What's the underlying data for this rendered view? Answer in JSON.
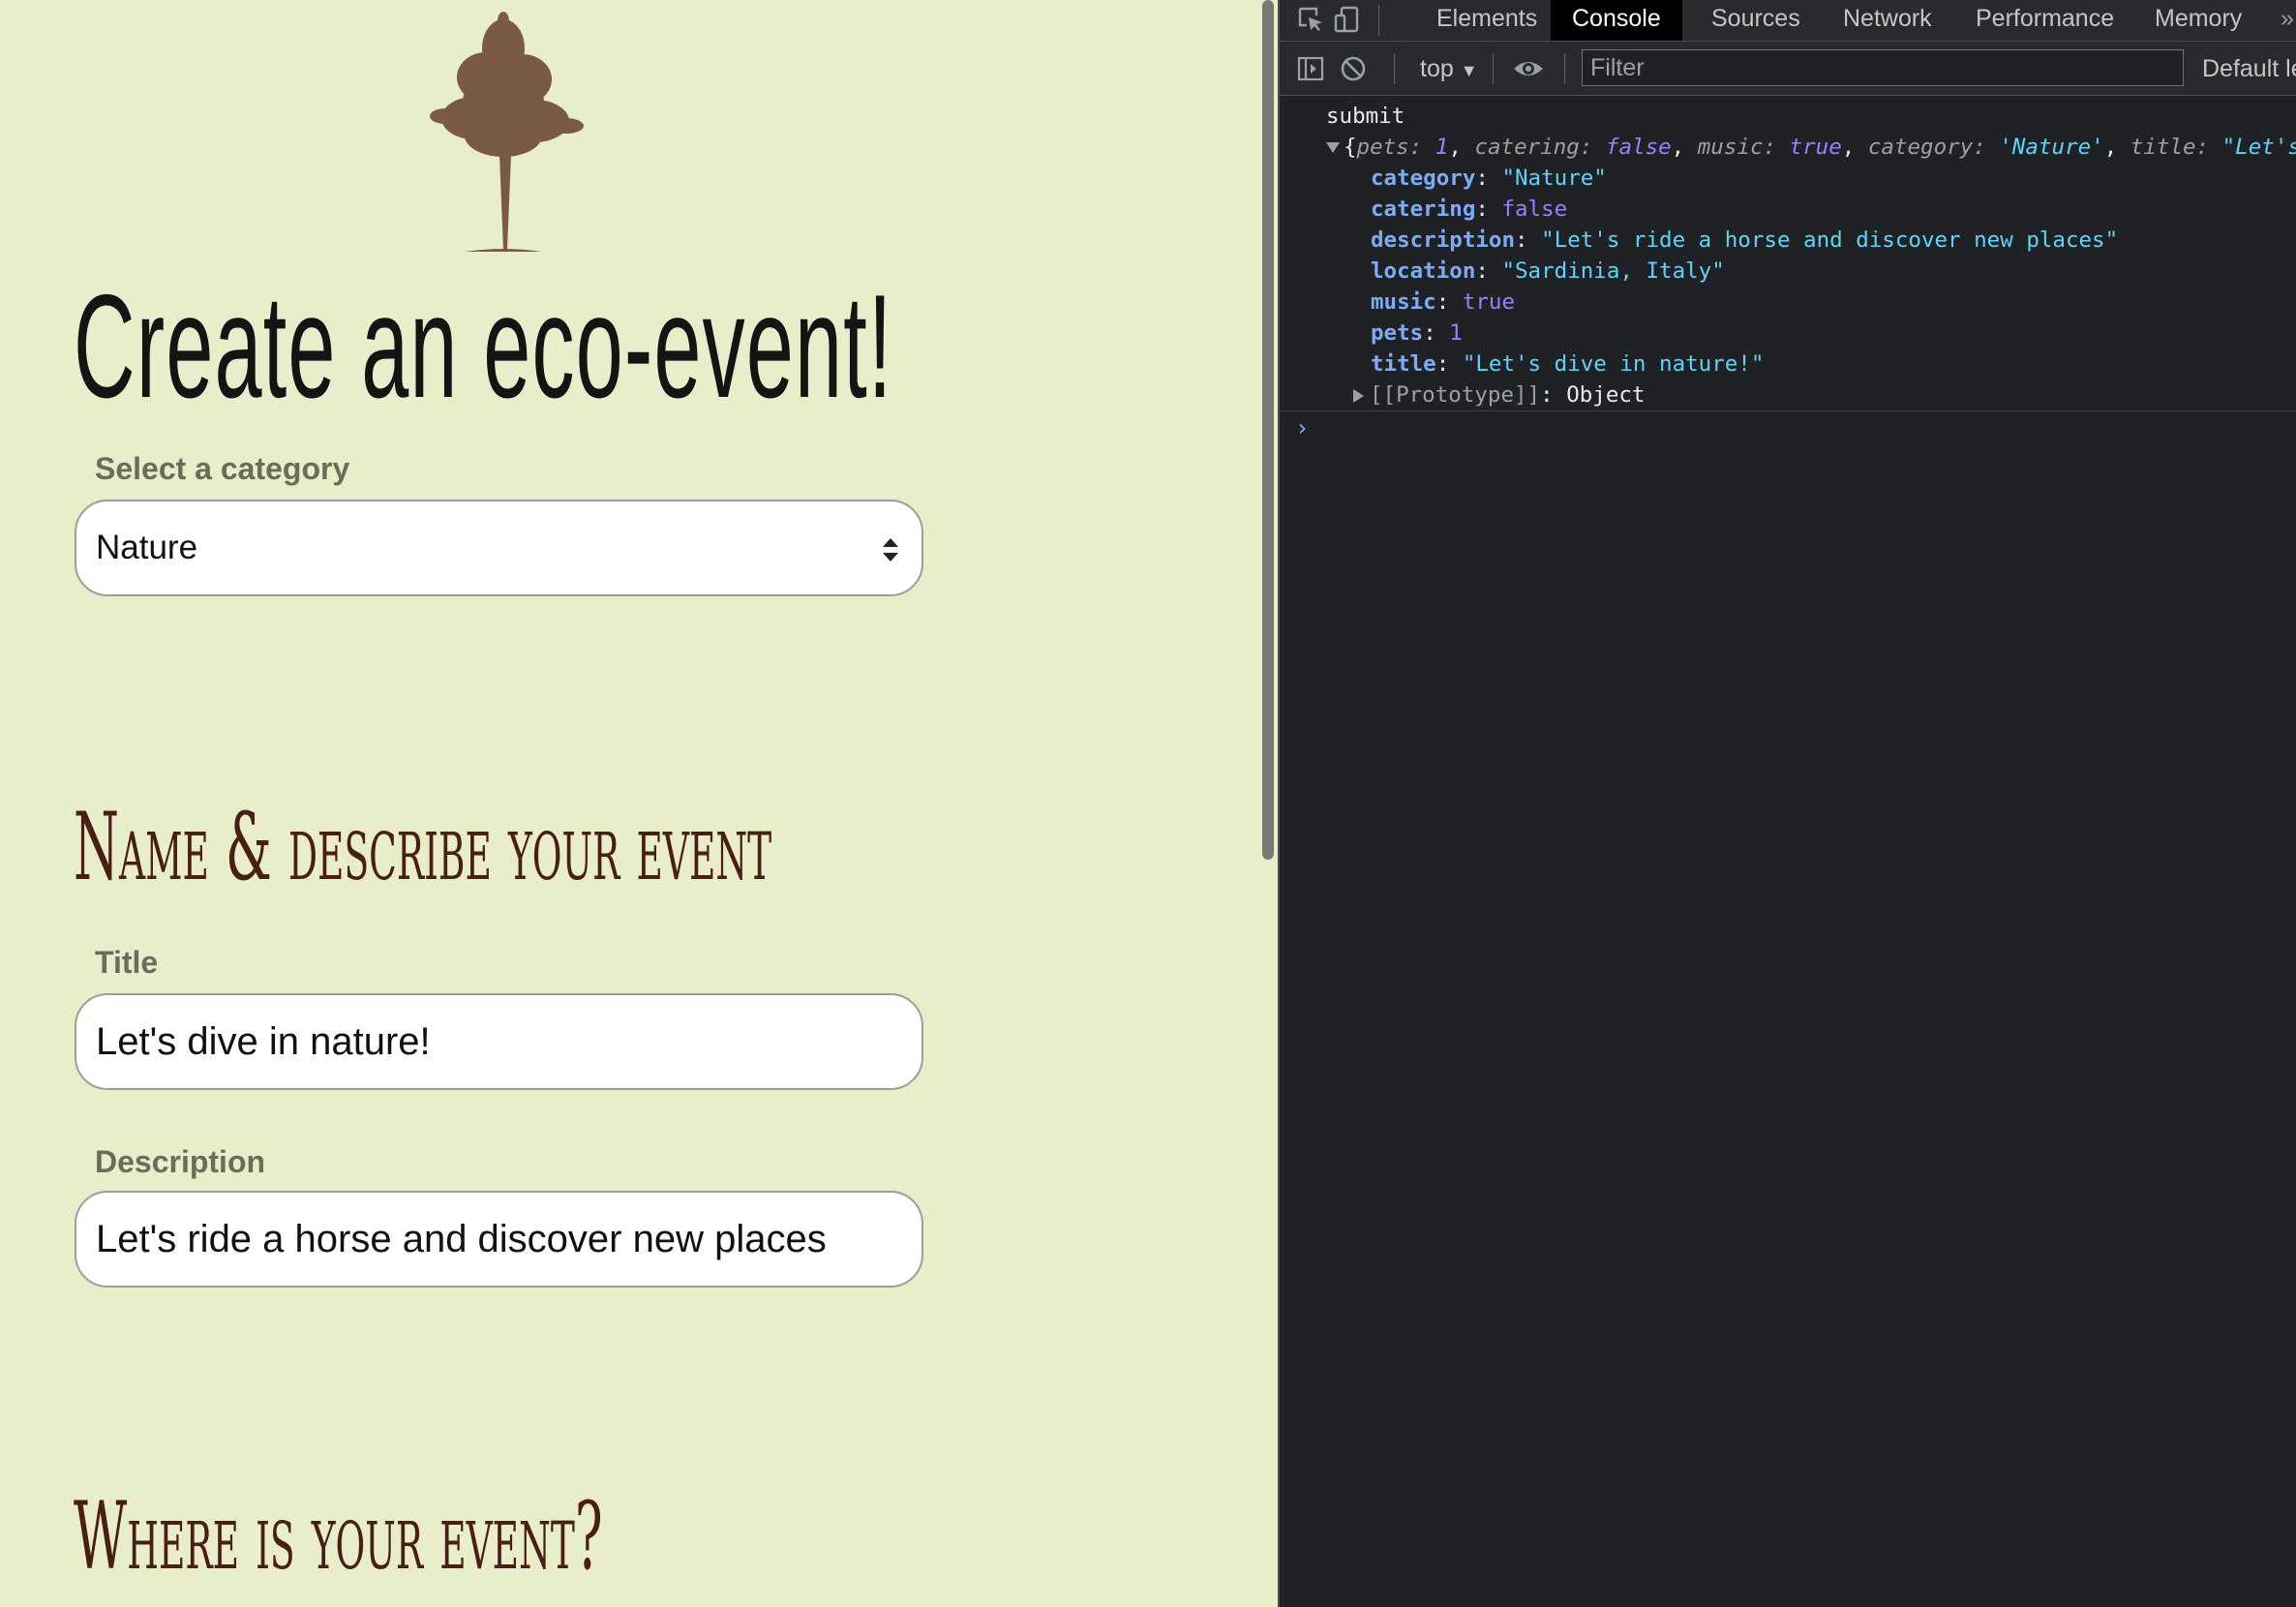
{
  "page": {
    "heading": "Create an eco-event!",
    "category": {
      "label": "Select a category",
      "selected": "Nature"
    },
    "section_name": "Name & describe your event",
    "title_field": {
      "label": "Title",
      "value": "Let's dive in nature!"
    },
    "description_field": {
      "label": "Description",
      "value": "Let's ride a horse and discover new places"
    },
    "section_where": "Where is your event?",
    "colors": {
      "background": "#e8eeca",
      "heading": "#141414",
      "section_heading": "#4a1e14",
      "label": "#6b6c5a",
      "tree": "#7a5a44"
    }
  },
  "devtools": {
    "tabs": [
      "Elements",
      "Console",
      "Sources",
      "Network",
      "Performance",
      "Memory"
    ],
    "active_tab": "Console",
    "more_tabs_icon": "chevron-double-right-icon",
    "context": "top",
    "filter_placeholder": "Filter",
    "levels": "Default le",
    "console": {
      "log_label": "submit",
      "preview": {
        "pets_key": "pets",
        "pets_val": "1",
        "catering_key": "catering",
        "catering_val": "false",
        "music_key": "music",
        "music_val": "true",
        "category_key": "category",
        "category_val": "'Nature'",
        "title_key": "title",
        "title_val": "\"Let's"
      },
      "properties": [
        {
          "key": "category",
          "value": "\"Nature\""
        },
        {
          "key": "catering",
          "value": "false"
        },
        {
          "key": "description",
          "value": "\"Let's ride a horse and discover new places\""
        },
        {
          "key": "location",
          "value": "\"Sardinia, Italy\""
        },
        {
          "key": "music",
          "value": "true"
        },
        {
          "key": "pets",
          "value": "1"
        },
        {
          "key": "title",
          "value": "\"Let's dive in nature!\""
        }
      ],
      "prototype_key": "[[Prototype]]",
      "prototype_val": "Object"
    }
  }
}
